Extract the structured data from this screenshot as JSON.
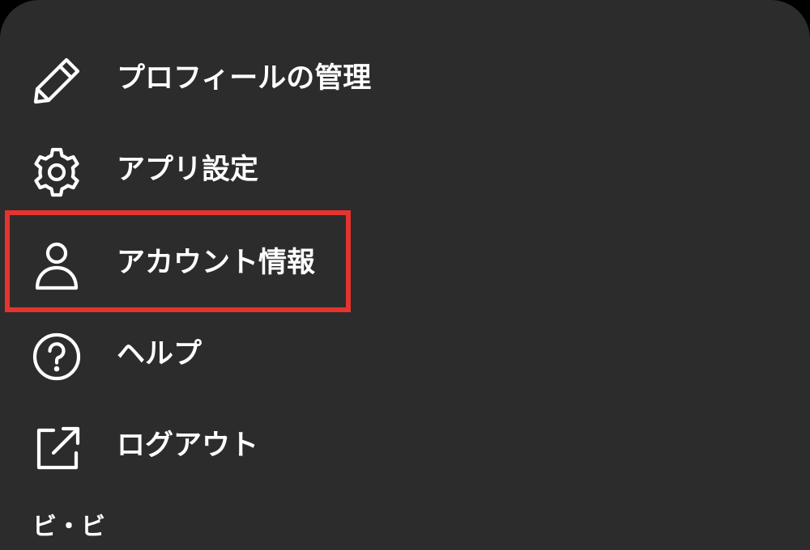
{
  "menu": {
    "items": [
      {
        "label": "プロフィールの管理",
        "icon": "pencil-icon"
      },
      {
        "label": "アプリ設定",
        "icon": "gear-icon"
      },
      {
        "label": "アカウント情報",
        "icon": "person-icon"
      },
      {
        "label": "ヘルプ",
        "icon": "help-circle-icon"
      },
      {
        "label": "ログアウト",
        "icon": "external-link-icon"
      }
    ],
    "highlighted_item": "アカウント情報",
    "partial_next_label": "ビ・ビ"
  },
  "colors": {
    "background": "#2c2c2c",
    "text": "#ffffff",
    "highlight": "#e5342f"
  }
}
